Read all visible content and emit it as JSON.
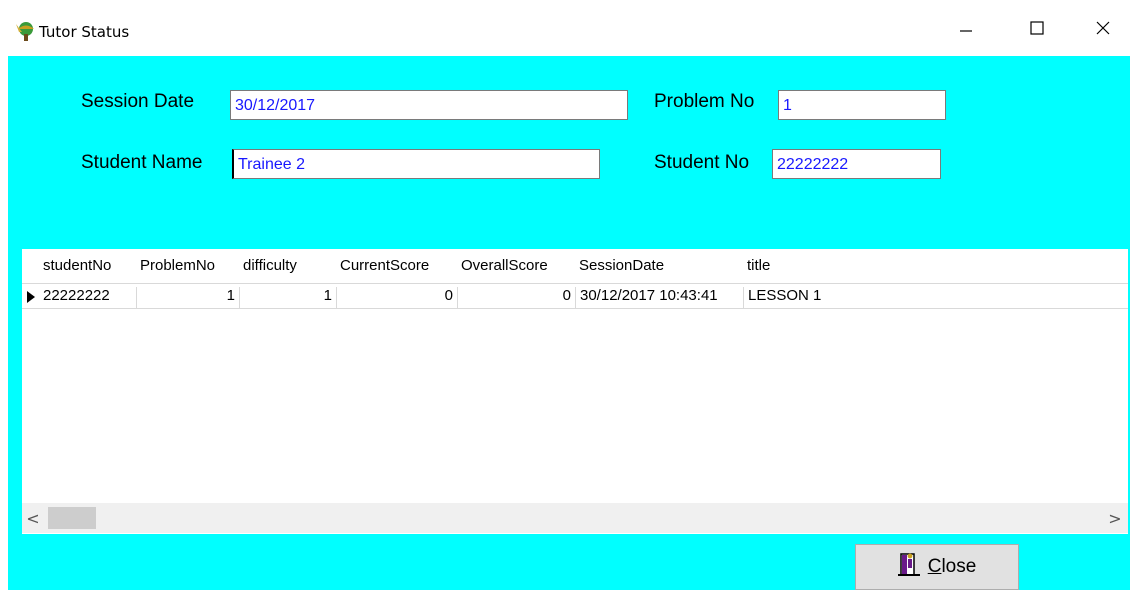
{
  "window": {
    "title": "Tutor Status",
    "controls": {
      "minimize": "–",
      "maximize": "□",
      "close": "✕"
    }
  },
  "form": {
    "session_date_label": "Session Date",
    "session_date_value": "30/12/2017",
    "problem_no_label": "Problem No",
    "problem_no_value": "1",
    "student_name_label": "Student Name",
    "student_name_value": "Trainee 2",
    "student_no_label": "Student No",
    "student_no_value": "22222222"
  },
  "grid": {
    "columns": [
      "studentNo",
      "ProblemNo",
      "difficulty",
      "CurrentScore",
      "OverallScore",
      "SessionDate",
      "title"
    ],
    "rows": [
      [
        "22222222",
        "1",
        "1",
        "0",
        "0",
        "30/12/2017 10:43:41",
        "LESSON 1"
      ]
    ]
  },
  "scrollbar": {
    "left_arrow": "<",
    "right_arrow": ">"
  },
  "buttons": {
    "close_label": "Close"
  },
  "icons": {
    "app": "app-icon",
    "close_button": "door-exit-icon",
    "row_indicator": "current-row-icon"
  },
  "colors": {
    "client_background": "#00ffff",
    "field_text": "#1818ff"
  }
}
